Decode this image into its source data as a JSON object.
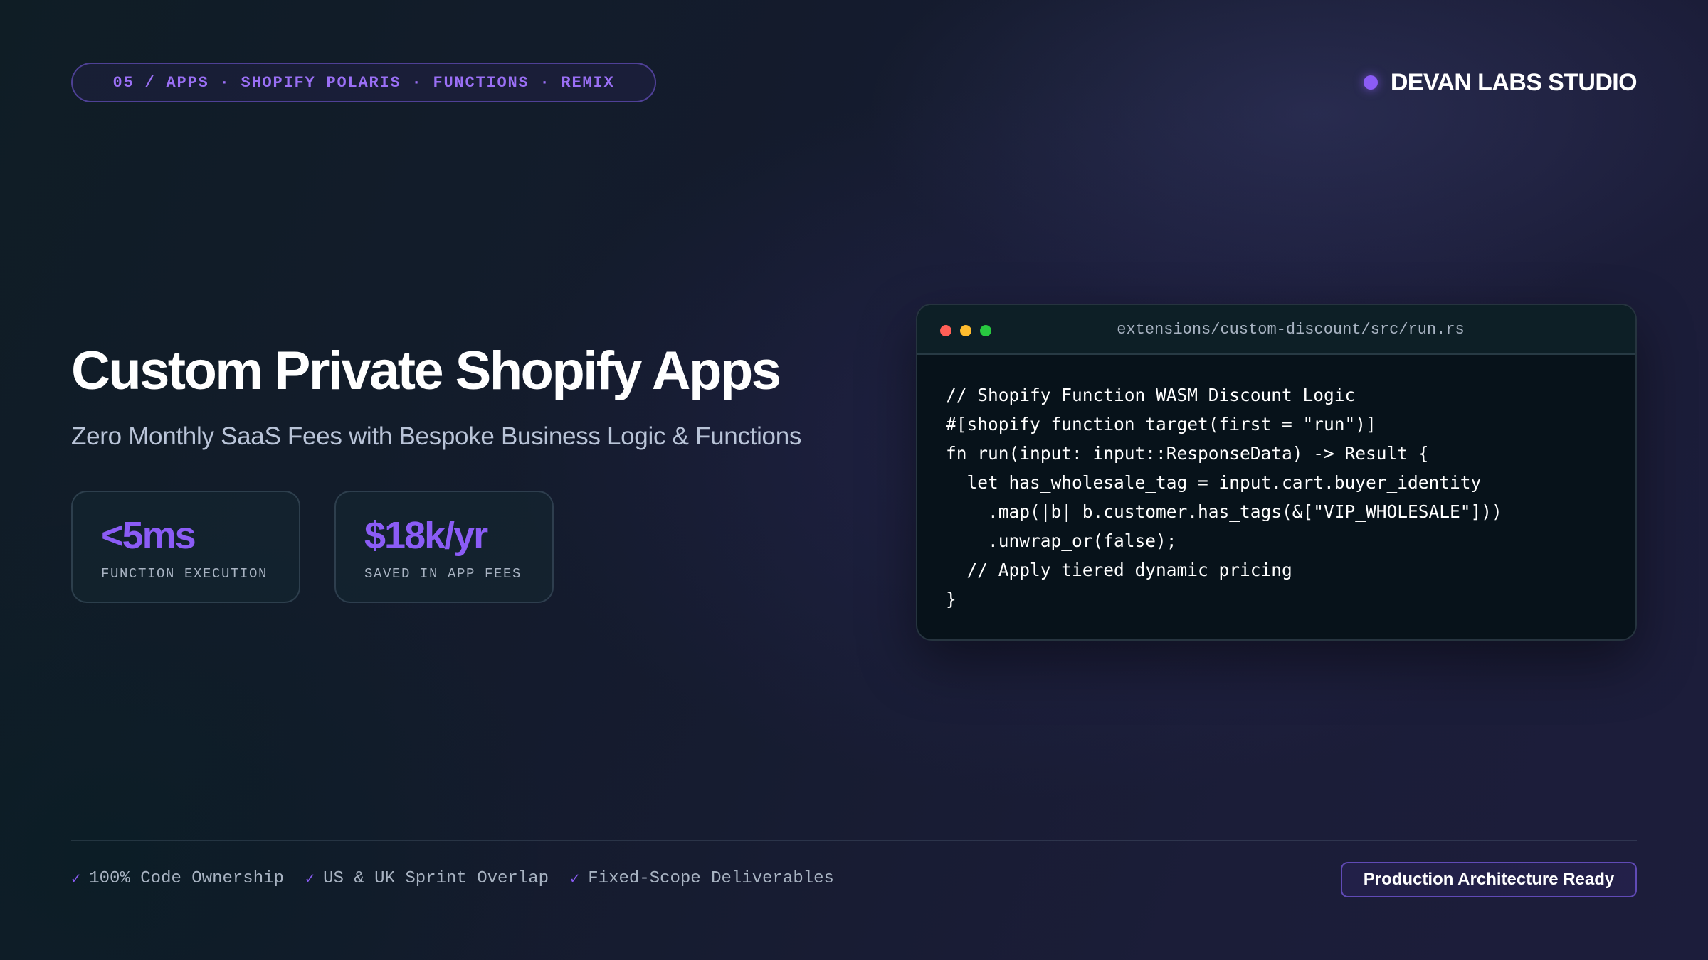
{
  "header": {
    "tag_line": "05 / APPS · SHOPIFY POLARIS · FUNCTIONS · REMIX",
    "brand_name": "DEVAN LABS STUDIO",
    "brand_dot_color": "#8b5cf6"
  },
  "hero": {
    "title": "Custom Private Shopify Apps",
    "subtitle": "Zero Monthly SaaS Fees with Bespoke Business Logic & Functions"
  },
  "metrics": [
    {
      "value": "<5ms",
      "label": "FUNCTION EXECUTION"
    },
    {
      "value": "$18k/yr",
      "label": "SAVED IN APP FEES"
    }
  ],
  "code_window": {
    "file_path": "extensions/custom-discount/src/run.rs",
    "lines": [
      "// Shopify Function WASM Discount Logic",
      "#[shopify_function_target(first = \"run\")]",
      "fn run(input: input::ResponseData) -> Result {",
      "  let has_wholesale_tag = input.cart.buyer_identity",
      "    .map(|b| b.customer.has_tags(&[\"VIP_WHOLESALE\"]))",
      "    .unwrap_or(false);",
      "  // Apply tiered dynamic pricing",
      "}"
    ],
    "window_dot_colors": [
      "#ff5f57",
      "#febc2e",
      "#28c840"
    ]
  },
  "footer": {
    "checks": [
      {
        "icon": "check-icon",
        "label": "100% Code Ownership"
      },
      {
        "icon": "check-icon",
        "label": "US & UK Sprint Overlap"
      },
      {
        "icon": "check-icon",
        "label": "Fixed-Scope Deliverables"
      }
    ],
    "check_glyph": "✓",
    "badge": "Production Architecture Ready"
  },
  "colors": {
    "accent": "#8b5cf6",
    "background": "#141b2d",
    "code_background": "#07121a"
  }
}
